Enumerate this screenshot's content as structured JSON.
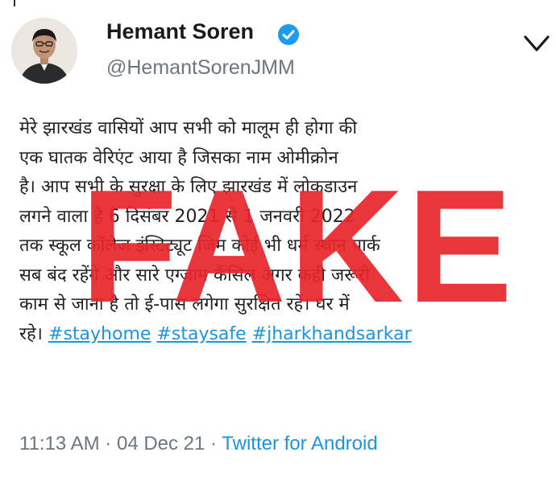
{
  "user": {
    "display_name": "Hemant Soren",
    "handle": "@HemantSorenJMM",
    "avatar_icon": "person-avatar-icon",
    "verified_icon": "verified-badge-icon"
  },
  "tweet": {
    "lines": [
      "मेरे झारखंड वासियों आप सभी को मालूम ही होगा की",
      "एक घातक वेरिएंट आया है जिसका नाम ओमीक्रोन",
      "है। आप सभी के सुरक्षा के लिए झारखंड में लोकडाउन",
      "लगने वाला है 6 दिसंबर 2021 से 1 जनवरी 2022",
      "तक स्कूल कॉलेज इंस्टिट्यूट जिम कोई भी धर्म स्थान पार्क",
      "सब बंद रहेंगे और सारे एग्जाम कैंसिल अगर कही जरूरी",
      "काम से जाना है तो ई-पास लगेगा सुरक्षित रहें। घर में"
    ],
    "last_line_prefix": "रहे।",
    "hashtags": [
      "#stayhome",
      "#staysafe",
      "#jharkhandsarkar"
    ]
  },
  "meta": {
    "time": "11:13 AM",
    "separator": "·",
    "date": "04 Dec 21",
    "source": "Twitter for Android"
  },
  "overlay": {
    "stamp_text": "FAKE",
    "color": "#e8262d"
  },
  "colors": {
    "link": "#1b95e0",
    "muted": "#6b7680",
    "text": "#222222",
    "verified": "#1d9bf0"
  },
  "icons": {
    "menu": "chevron-down-icon"
  }
}
